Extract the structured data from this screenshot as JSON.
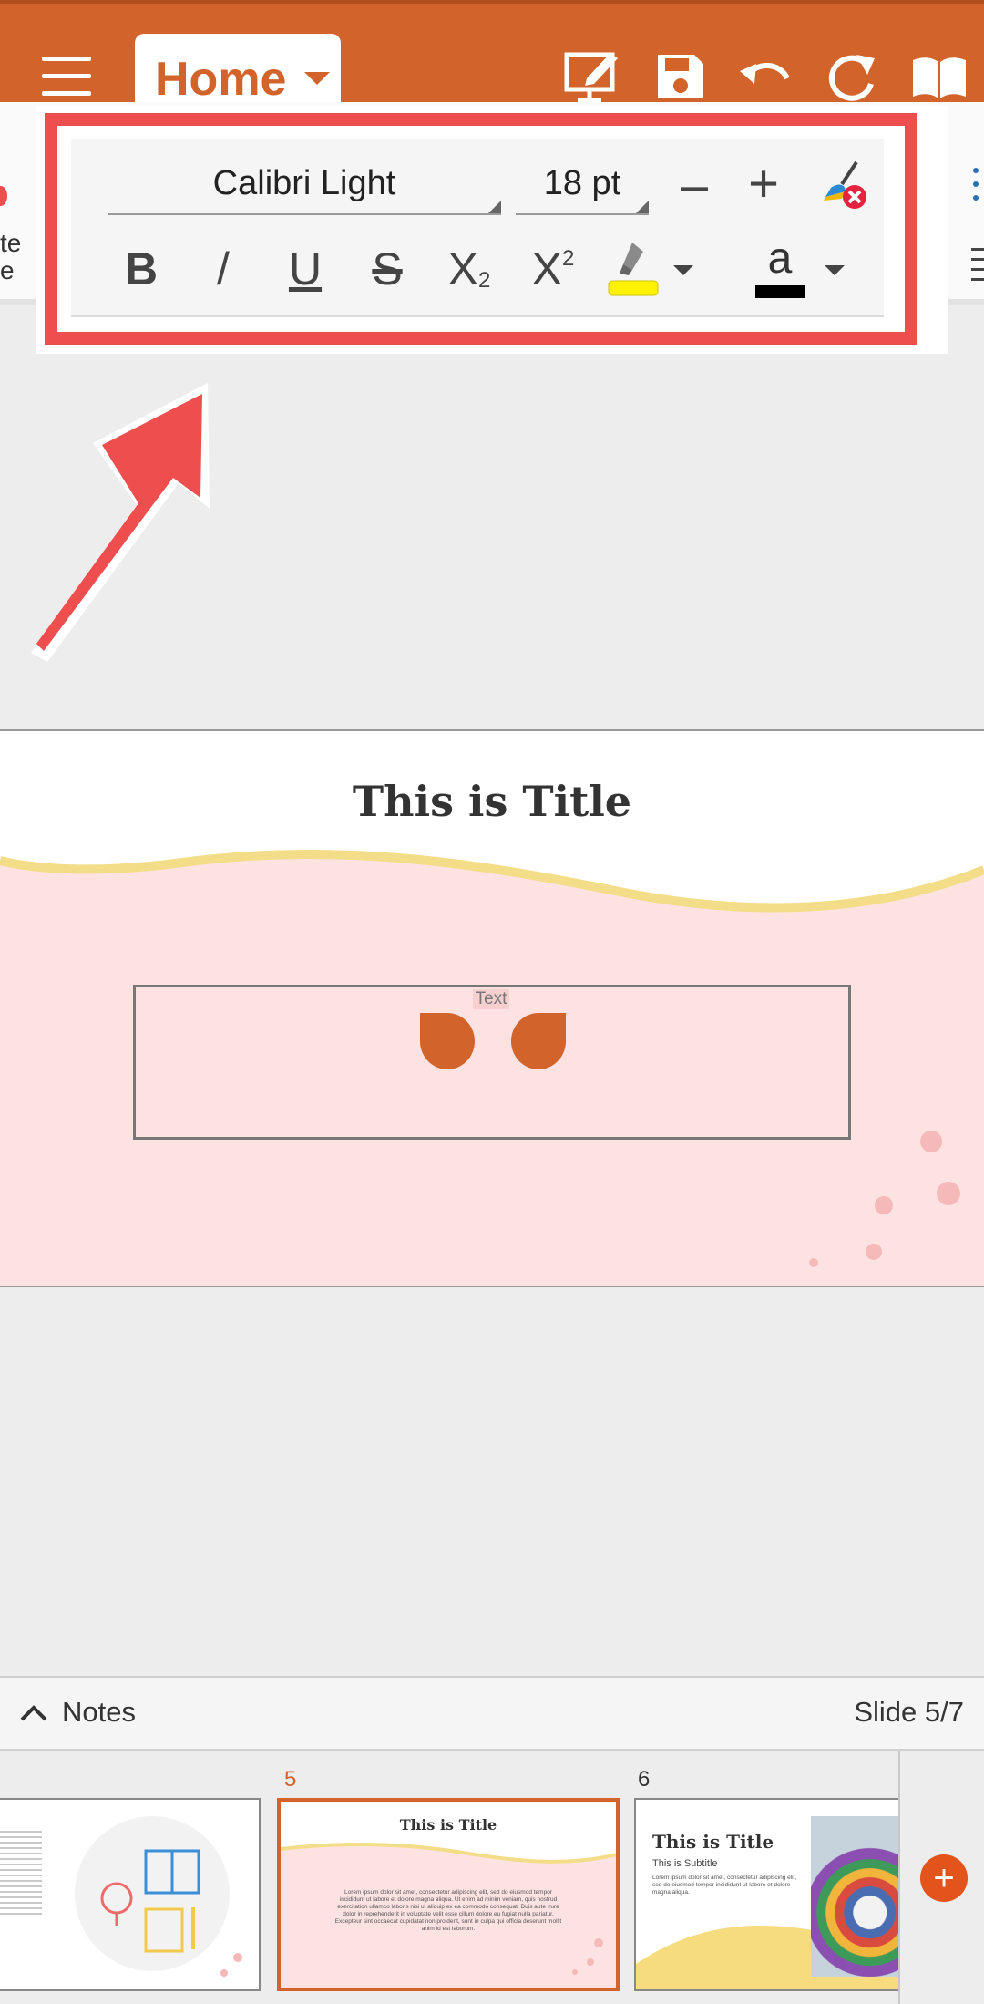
{
  "toolbar": {
    "menu_icon": "hamburger-menu-icon",
    "tab_label": "Home",
    "icons": [
      "presentation-edit-icon",
      "save-icon",
      "undo-icon",
      "redo-icon",
      "book-icon"
    ]
  },
  "ribbon": {
    "left_partial_text_1": "te",
    "left_partial_text_2": "e"
  },
  "font_popup": {
    "font_name": "Calibri Light",
    "font_size": "18 pt",
    "decrease_symbol": "–",
    "increase_symbol": "+",
    "bold": "B",
    "italic": "/",
    "underline": "U",
    "strikethrough": "S",
    "subscript_base": "X",
    "subscript_mark": "2",
    "superscript_base": "X",
    "superscript_mark": "2",
    "font_color_letter": "a",
    "colors": {
      "highlight": "#fff200",
      "font_color": "#000000",
      "accent": "#d2632a",
      "annotation_red": "#ee4e4e"
    }
  },
  "slide": {
    "title": "This is Title",
    "textbox_label": "Text"
  },
  "notes_bar": {
    "label": "Notes",
    "slide_counter": "Slide 5/7"
  },
  "thumbnails": [
    {
      "number": "",
      "title": ""
    },
    {
      "number": "5",
      "title": "This is Title",
      "body": "Lorem ipsum dolor sit amet, consectetur adipiscing elit, sed do eiusmod tempor incididunt ut labore et dolore magna aliqua. Ut enim ad minim veniam, quis nostrud exercitation ullamco laboris nisi ut aliquip ex ea commodo consequat. Duis aute irure dolor in reprehenderit in voluptate velit esse cillum dolore eu fugiat nulla pariatur. Excepteur sint occaecat cupidatat non proident, sunt in culpa qui officia deserunt mollit anim id est laborum."
    },
    {
      "number": "6",
      "title": "This is Title",
      "subtitle": "This is Subtitle",
      "body": "Lorem ipsum dolor sit amet, consectetur adipiscing elit, sed do eiusmod tempor incididunt ut labore et dolore magna aliqua."
    }
  ],
  "add_slide_symbol": "+"
}
